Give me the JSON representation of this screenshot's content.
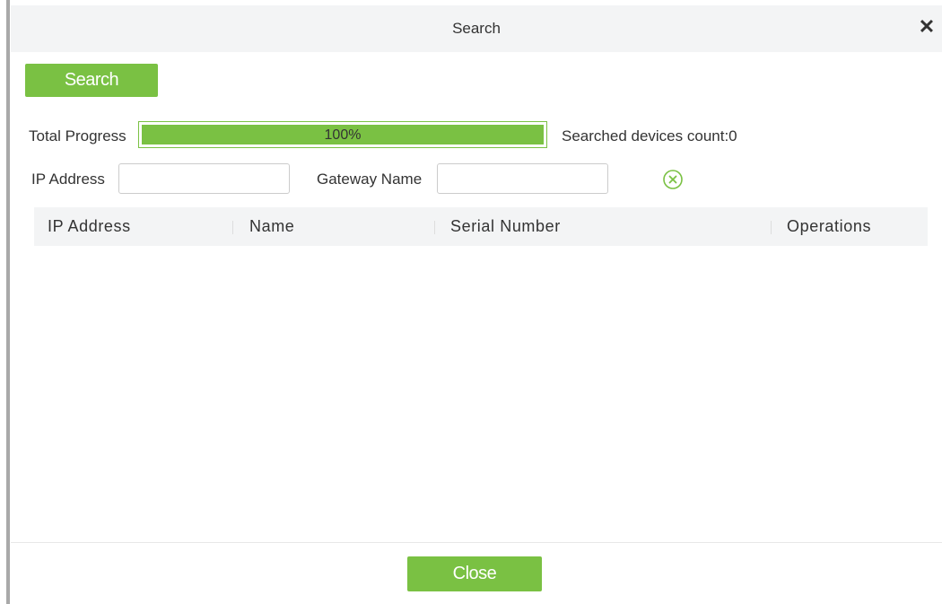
{
  "dialog": {
    "title": "Search",
    "close_symbol": "✕"
  },
  "toolbar": {
    "search_label": "Search"
  },
  "progress": {
    "label": "Total Progress",
    "value_percent": 100,
    "text": "100%",
    "count_label": "Searched devices count:0"
  },
  "filters": {
    "ip_label": "IP Address",
    "ip_value": "",
    "gateway_label": "Gateway Name",
    "gateway_value": "",
    "clear_icon": "circle-x-icon"
  },
  "table": {
    "columns": [
      "IP Address",
      "Name",
      "Serial Number",
      "Operations"
    ],
    "rows": []
  },
  "footer": {
    "close_label": "Close"
  },
  "colors": {
    "accent": "#7ac143",
    "header_bg": "#f3f4f5",
    "text": "#333333"
  }
}
